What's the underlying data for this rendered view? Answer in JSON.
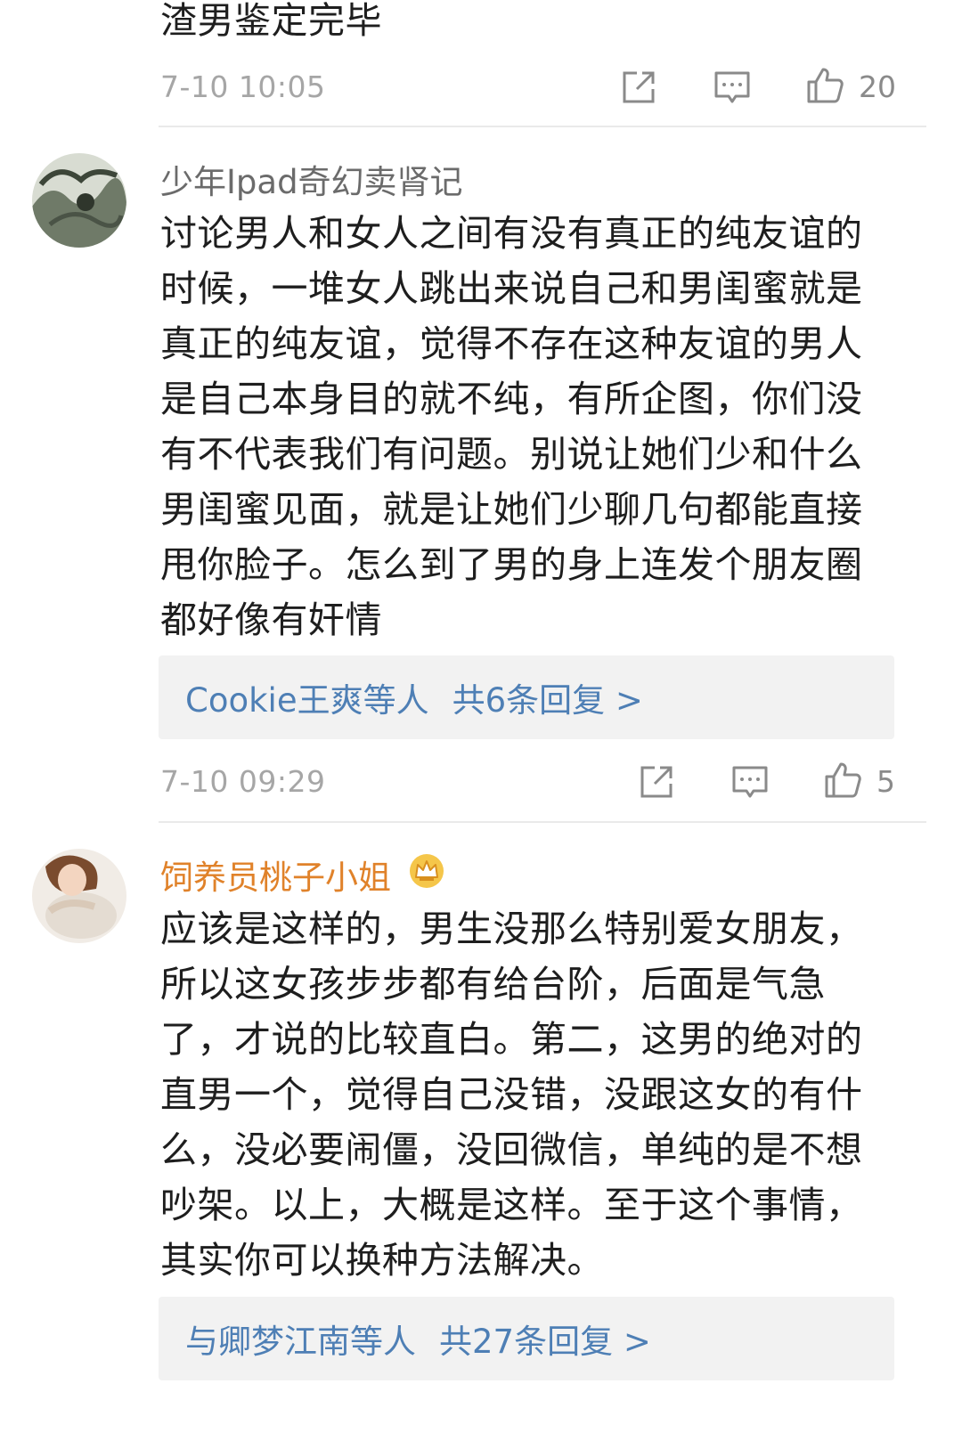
{
  "top_comment": {
    "text": "渣男鉴定完毕",
    "time": "7-10 10:05",
    "likes": "20"
  },
  "comments": [
    {
      "username": "少年Ipad奇幻卖肾记",
      "lines": [
        "讨论男人和女人之间有没有真正的纯友谊的",
        "时候，一堆女人跳出来说自己和男闺蜜就是",
        "真正的纯友谊，觉得不存在这种友谊的男人",
        "是自己本身目的就不纯，有所企图，你们没",
        "有不代表我们有问题。别说让她们少和什么",
        "男闺蜜见面，就是让她们少聊几句都能直接",
        "甩你脸子。怎么到了男的身上连发个朋友圈",
        "都好像有奸情"
      ],
      "reply_users": "Cookie王爽等人",
      "reply_count": "共6条回复 >",
      "time": "7-10 09:29",
      "likes": "5"
    },
    {
      "username": "饲养员桃子小姐",
      "lines": [
        "应该是这样的，男生没那么特别爱女朋友，",
        "所以这女孩步步都有给台阶，后面是气急",
        "了，才说的比较直白。第二，这男的绝对的",
        "直男一个，觉得自己没错，没跟这女的有什",
        "么，没必要闹僵，没回微信，单纯的是不想",
        "吵架。以上，大概是这样。至于这个事情，",
        "其实你可以换种方法解决。"
      ],
      "reply_users": "与卿梦江南等人",
      "reply_count": "共27条回复 >"
    }
  ],
  "colors": {
    "link": "#4e7fb5",
    "vip_name": "#e0822a",
    "meta": "#a6a6a6",
    "reply_bg": "#f2f2f2"
  },
  "icons": [
    "share-icon",
    "comment-icon",
    "like-icon",
    "crown-badge-icon"
  ]
}
